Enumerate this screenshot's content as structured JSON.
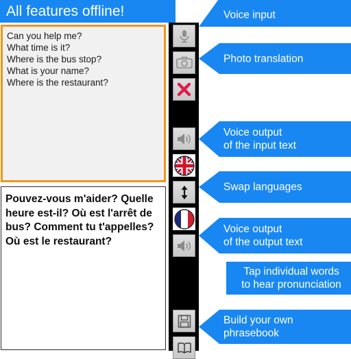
{
  "app": {
    "header_title": "All features offline!",
    "accent_blue": "#1887f2",
    "input_border_orange": "#f2941b",
    "icon_column_bg": "#000000"
  },
  "input_panel": {
    "lines": [
      "Can you help me?",
      "What time is it?",
      "Where is the bus stop?",
      "What is your name?",
      "Where is the restaurant?"
    ]
  },
  "output_panel": {
    "text": "Pouvez-vous m'aider? Quelle heure est-il? Où est l'arrêt de bus? Comment tu t'appelles? Où est le restaurant?"
  },
  "icon_column": {
    "buttons": [
      {
        "name": "microphone-icon",
        "label": "Voice input"
      },
      {
        "name": "camera-icon",
        "label": "Photo translation"
      },
      {
        "name": "clear-x-icon",
        "label": "Clear text"
      },
      {
        "name": "speaker-input-icon",
        "label": "Voice output of the input text"
      },
      {
        "name": "uk-flag-icon",
        "label": "English"
      },
      {
        "name": "swap-arrows-icon",
        "label": "Swap languages"
      },
      {
        "name": "france-flag-icon",
        "label": "French"
      },
      {
        "name": "speaker-output-icon",
        "label": "Voice output of the output text"
      },
      {
        "name": "save-floppy-icon",
        "label": "Save phrase"
      },
      {
        "name": "phrasebook-icon",
        "label": "Phrasebook"
      }
    ]
  },
  "callouts": [
    {
      "id": "voice-input",
      "text": "Voice input"
    },
    {
      "id": "photo-translation",
      "text": "Photo translation"
    },
    {
      "id": "voice-output-input",
      "text": "Voice output\nof the input text"
    },
    {
      "id": "swap-languages",
      "text": "Swap languages"
    },
    {
      "id": "voice-output-output",
      "text": "Voice output\nof the output text"
    },
    {
      "id": "tap-words",
      "text": "Tap individual words\nto hear pronunciation"
    },
    {
      "id": "phrasebook",
      "text": "Build your own\nphrasebook"
    }
  ]
}
